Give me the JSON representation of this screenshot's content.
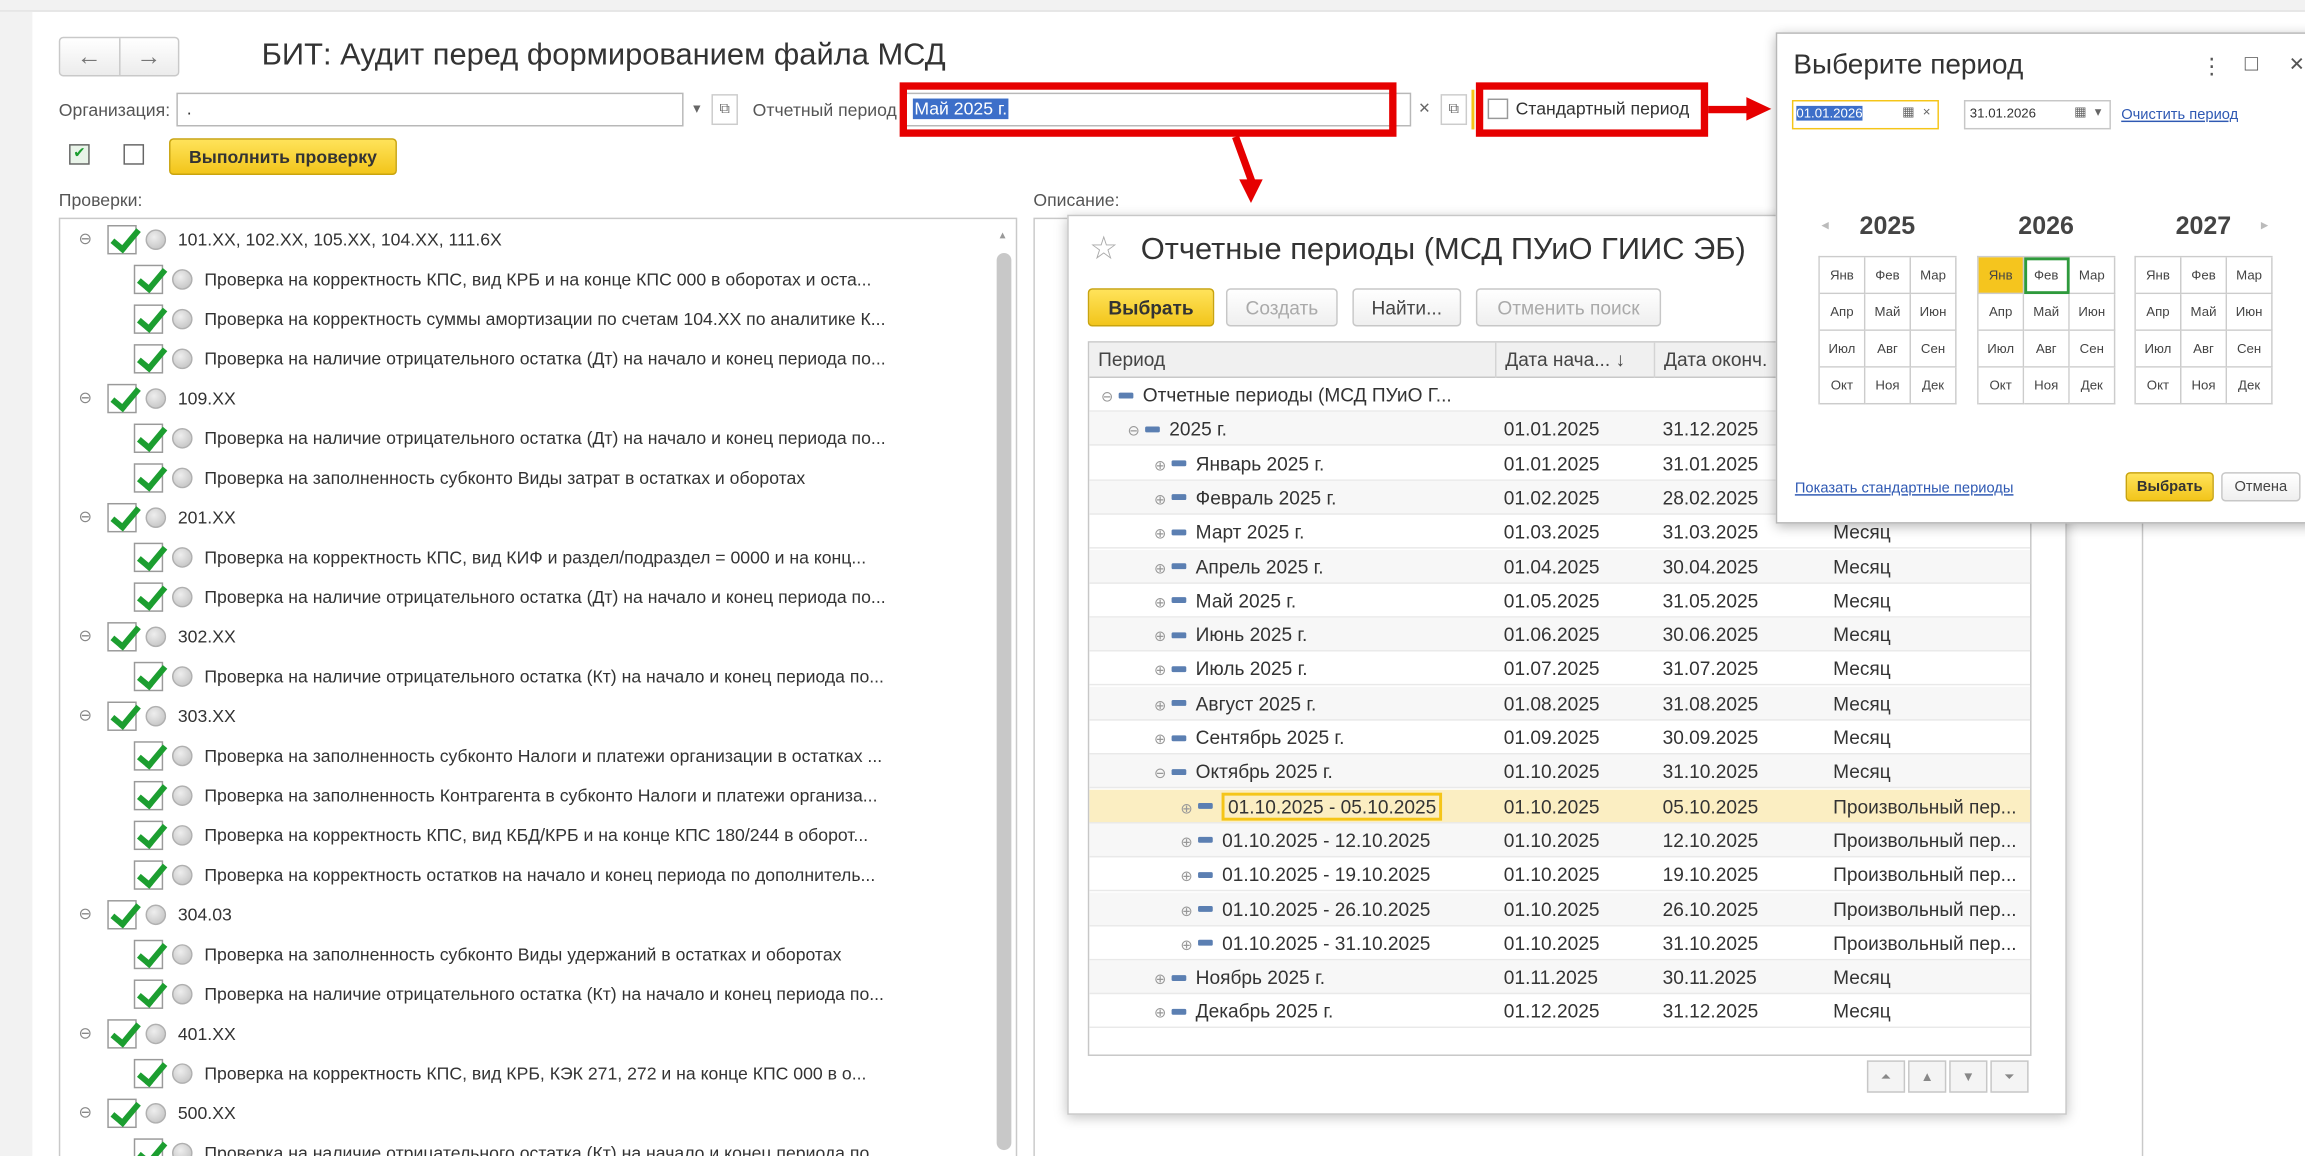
{
  "window": {
    "title": "БИТ: Аудит перед формированием файла МСД",
    "back_icon": "←",
    "forward_icon": "→"
  },
  "form": {
    "org_label": "Организация:",
    "org_value": ".",
    "period_label": "Отчетный период",
    "period_value": "Май 2025 г.",
    "standard_period_label": "Стандартный период",
    "run_check_label": "Выполнить проверку",
    "checks_label": "Проверки:",
    "description_label": "Описание:"
  },
  "checks": [
    {
      "level": 0,
      "text": "101.XX, 102.XX, 105.XX, 104.XX, 111.6X"
    },
    {
      "level": 1,
      "text": "Проверка на корректность КПС, вид КРБ и на конце КПС 000 в оборотах и оста..."
    },
    {
      "level": 1,
      "text": "Проверка на корректность суммы амортизации по счетам 104.XX по аналитике К..."
    },
    {
      "level": 1,
      "text": "Проверка на наличие отрицательного остатка (Дт) на начало и конец периода по..."
    },
    {
      "level": 0,
      "text": "109.XX"
    },
    {
      "level": 1,
      "text": "Проверка на наличие отрицательного остатка (Дт) на начало и конец периода по..."
    },
    {
      "level": 1,
      "text": "Проверка на заполненность субконто Виды затрат в остатках и оборотах"
    },
    {
      "level": 0,
      "text": "201.XX"
    },
    {
      "level": 1,
      "text": "Проверка на корректность КПС, вид КИФ и раздел/подраздел = 0000 и на конц..."
    },
    {
      "level": 1,
      "text": "Проверка на наличие отрицательного остатка (Дт) на начало и конец периода по..."
    },
    {
      "level": 0,
      "text": "302.XX"
    },
    {
      "level": 1,
      "text": "Проверка на наличие отрицательного остатка (Кт) на начало и конец периода по..."
    },
    {
      "level": 0,
      "text": "303.XX"
    },
    {
      "level": 1,
      "text": "Проверка на заполненность субконто Налоги и платежи организации в остатках ..."
    },
    {
      "level": 1,
      "text": "Проверка на заполненность Контрагента в субконто Налоги и платежи организа..."
    },
    {
      "level": 1,
      "text": "Проверка на корректность КПС, вид КБД/КРБ и на конце КПС 180/244 в оборот..."
    },
    {
      "level": 1,
      "text": "Проверка на корректность остатков на начало и конец периода по дополнитель..."
    },
    {
      "level": 0,
      "text": "304.03"
    },
    {
      "level": 1,
      "text": "Проверка на заполненность субконто Виды удержаний в остатках и оборотах"
    },
    {
      "level": 1,
      "text": "Проверка на наличие отрицательного остатка (Кт) на начало и конец периода по..."
    },
    {
      "level": 0,
      "text": "401.XX"
    },
    {
      "level": 1,
      "text": "Проверка на корректность КПС, вид КРБ, КЭК 271, 272 и на конце КПС 000 в о..."
    },
    {
      "level": 0,
      "text": "500.XX"
    },
    {
      "level": 1,
      "text": "Проверка на наличие отрицательного остатка (Кт) на начало и конец периода по..."
    }
  ],
  "periods_dialog": {
    "title": "Отчетные периоды (МСД ПУиО ГИИС ЭБ)",
    "select_label": "Выбрать",
    "create_label": "Создать",
    "find_label": "Найти...",
    "cancel_search_label": "Отменить поиск",
    "columns": [
      "Период",
      "Дата нача...",
      "Дата оконч."
    ],
    "sort_icon": "↓",
    "rows": [
      {
        "indent": 0,
        "exp": "⊖",
        "name": "Отчетные периоды (МСД ПУиО Г...",
        "start": "",
        "end": "",
        "kind": ""
      },
      {
        "indent": 1,
        "exp": "⊖",
        "name": "2025 г.",
        "start": "01.01.2025",
        "end": "31.12.2025",
        "kind": ""
      },
      {
        "indent": 2,
        "exp": "⊕",
        "name": "Январь 2025 г.",
        "start": "01.01.2025",
        "end": "31.01.2025",
        "kind": ""
      },
      {
        "indent": 2,
        "exp": "⊕",
        "name": "Февраль 2025 г.",
        "start": "01.02.2025",
        "end": "28.02.2025",
        "kind": ""
      },
      {
        "indent": 2,
        "exp": "⊕",
        "name": "Март 2025 г.",
        "start": "01.03.2025",
        "end": "31.03.2025",
        "kind": "Месяц"
      },
      {
        "indent": 2,
        "exp": "⊕",
        "name": "Апрель 2025 г.",
        "start": "01.04.2025",
        "end": "30.04.2025",
        "kind": "Месяц"
      },
      {
        "indent": 2,
        "exp": "⊕",
        "name": "Май 2025 г.",
        "start": "01.05.2025",
        "end": "31.05.2025",
        "kind": "Месяц"
      },
      {
        "indent": 2,
        "exp": "⊕",
        "name": "Июнь 2025 г.",
        "start": "01.06.2025",
        "end": "30.06.2025",
        "kind": "Месяц"
      },
      {
        "indent": 2,
        "exp": "⊕",
        "name": "Июль 2025 г.",
        "start": "01.07.2025",
        "end": "31.07.2025",
        "kind": "Месяц"
      },
      {
        "indent": 2,
        "exp": "⊕",
        "name": "Август 2025 г.",
        "start": "01.08.2025",
        "end": "31.08.2025",
        "kind": "Месяц"
      },
      {
        "indent": 2,
        "exp": "⊕",
        "name": "Сентябрь 2025 г.",
        "start": "01.09.2025",
        "end": "30.09.2025",
        "kind": "Месяц"
      },
      {
        "indent": 2,
        "exp": "⊖",
        "name": "Октябрь 2025 г.",
        "start": "01.10.2025",
        "end": "31.10.2025",
        "kind": "Месяц"
      },
      {
        "indent": 3,
        "exp": "⊕",
        "name": "01.10.2025 - 05.10.2025",
        "start": "01.10.2025",
        "end": "05.10.2025",
        "kind": "Произвольный пер...",
        "selected": true
      },
      {
        "indent": 3,
        "exp": "⊕",
        "name": "01.10.2025 - 12.10.2025",
        "start": "01.10.2025",
        "end": "12.10.2025",
        "kind": "Произвольный пер..."
      },
      {
        "indent": 3,
        "exp": "⊕",
        "name": "01.10.2025 - 19.10.2025",
        "start": "01.10.2025",
        "end": "19.10.2025",
        "kind": "Произвольный пер..."
      },
      {
        "indent": 3,
        "exp": "⊕",
        "name": "01.10.2025 - 26.10.2025",
        "start": "01.10.2025",
        "end": "26.10.2025",
        "kind": "Произвольный пер..."
      },
      {
        "indent": 3,
        "exp": "⊕",
        "name": "01.10.2025 - 31.10.2025",
        "start": "01.10.2025",
        "end": "31.10.2025",
        "kind": "Произвольный пер..."
      },
      {
        "indent": 2,
        "exp": "⊕",
        "name": "Ноябрь 2025 г.",
        "start": "01.11.2025",
        "end": "30.11.2025",
        "kind": "Месяц"
      },
      {
        "indent": 2,
        "exp": "⊕",
        "name": "Декабрь 2025 г.",
        "start": "01.12.2025",
        "end": "31.12.2025",
        "kind": "Месяц"
      }
    ]
  },
  "picker": {
    "title": "Выберите период",
    "menu_icon": "⋮",
    "maximize_icon": "□",
    "close_icon": "✕",
    "date_from": "01.01.2026",
    "date_to": "31.01.2026",
    "clear_link": "Очистить период",
    "prev_icon": "◂",
    "next_icon": "▸",
    "years": [
      {
        "year": "2025",
        "months": [
          "Янв",
          "Фев",
          "Мар",
          "Апр",
          "Май",
          "Июн",
          "Июл",
          "Авг",
          "Сен",
          "Окт",
          "Ноя",
          "Дек"
        ]
      },
      {
        "year": "2026",
        "months": [
          "Янв",
          "Фев",
          "Мар",
          "Апр",
          "Май",
          "Июн",
          "Июл",
          "Авг",
          "Сен",
          "Окт",
          "Ноя",
          "Дек"
        ]
      },
      {
        "year": "2027",
        "months": [
          "Янв",
          "Фев",
          "Мар",
          "Апр",
          "Май",
          "Июн",
          "Июл",
          "Авг",
          "Сен",
          "Окт",
          "Ноя",
          "Дек"
        ]
      }
    ],
    "show_standard_link": "Показать стандартные периоды",
    "select_label": "Выбрать",
    "cancel_label": "Отмена"
  },
  "colors": {
    "accent_yellow": "#f5c51e",
    "annotation_red": "#e60000",
    "check_green": "#1c9e30"
  }
}
